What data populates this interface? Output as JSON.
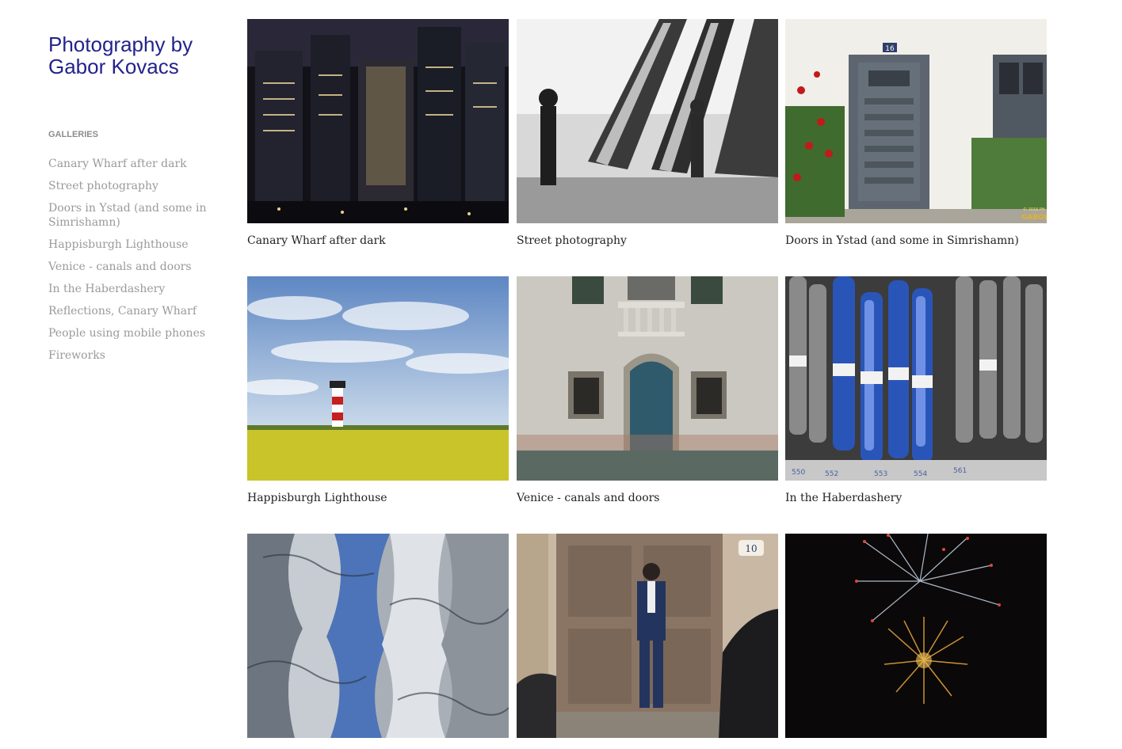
{
  "site": {
    "title_line1": "Photography by",
    "title_line2": "Gabor Kovacs"
  },
  "sidebar": {
    "heading": "GALLERIES",
    "items": [
      {
        "label": "Canary Wharf after dark"
      },
      {
        "label": "Street photography"
      },
      {
        "label": "Doors in Ystad (and some in Simrishamn)"
      },
      {
        "label": "Happisburgh Lighthouse"
      },
      {
        "label": "Venice - canals and doors"
      },
      {
        "label": "In the Haberdashery"
      },
      {
        "label": "Reflections, Canary Wharf"
      },
      {
        "label": "People using mobile phones"
      },
      {
        "label": "Fireworks"
      }
    ]
  },
  "gallery": {
    "tiles": [
      {
        "caption": "Canary Wharf after dark"
      },
      {
        "caption": "Street photography"
      },
      {
        "caption": "Doors in Ystad (and some in Simrishamn)",
        "photo_text": {
          "number": "16",
          "credit": "© 2016 PH",
          "signature": "GABOR"
        }
      },
      {
        "caption": "Happisburgh Lighthouse"
      },
      {
        "caption": "Venice - canals and doors"
      },
      {
        "caption": "In the Haberdashery",
        "photo_text": {
          "n1": "550",
          "n2": "552",
          "n3": "553",
          "n4": "554",
          "n5": "561"
        }
      },
      {
        "caption": ""
      },
      {
        "caption": "",
        "photo_text": {
          "number": "10"
        }
      },
      {
        "caption": ""
      }
    ]
  },
  "colors": {
    "title": "#23238c",
    "nav_text": "#9a9a9a",
    "caption_text": "#222222"
  }
}
